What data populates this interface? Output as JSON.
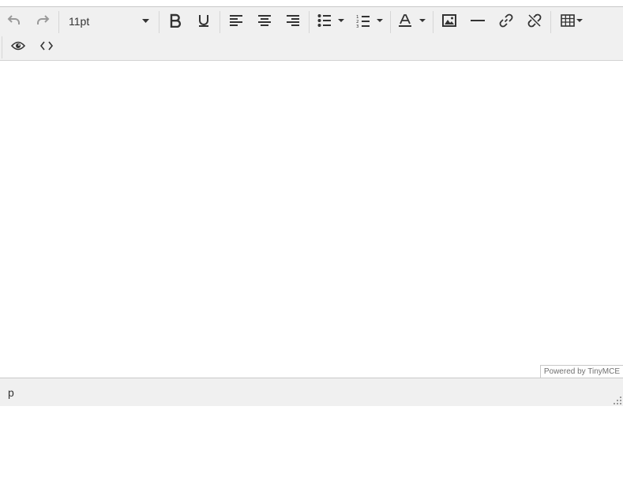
{
  "toolbar": {
    "font_size_value": "11pt",
    "buttons": [
      {
        "name": "undo-button",
        "icon": "undo-icon",
        "enabled": false
      },
      {
        "name": "redo-button",
        "icon": "redo-icon",
        "enabled": false
      },
      {
        "name": "bold-button",
        "icon": "bold-icon"
      },
      {
        "name": "underline-button",
        "icon": "underline-icon"
      },
      {
        "name": "align-left-button",
        "icon": "align-left-icon"
      },
      {
        "name": "align-center-button",
        "icon": "align-center-icon"
      },
      {
        "name": "align-right-button",
        "icon": "align-right-icon"
      },
      {
        "name": "bullet-list-button",
        "icon": "bullet-list-icon"
      },
      {
        "name": "numbered-list-button",
        "icon": "numbered-list-icon"
      },
      {
        "name": "text-color-button",
        "icon": "text-color-icon"
      },
      {
        "name": "image-button",
        "icon": "image-icon"
      },
      {
        "name": "horizontal-rule-button",
        "icon": "horizontal-rule-icon"
      },
      {
        "name": "link-button",
        "icon": "link-icon"
      },
      {
        "name": "unlink-button",
        "icon": "unlink-icon"
      },
      {
        "name": "table-button",
        "icon": "table-icon"
      },
      {
        "name": "preview-button",
        "icon": "eye-icon"
      },
      {
        "name": "source-code-button",
        "icon": "code-icon"
      }
    ]
  },
  "branding": {
    "text": "Powered by TinyMCE"
  },
  "statusbar": {
    "path": "p"
  },
  "colors": {
    "toolbar_bg": "#f0f0f0",
    "icon": "#333333",
    "disabled_icon": "#9a9a9a",
    "border": "#c8c8c8"
  }
}
